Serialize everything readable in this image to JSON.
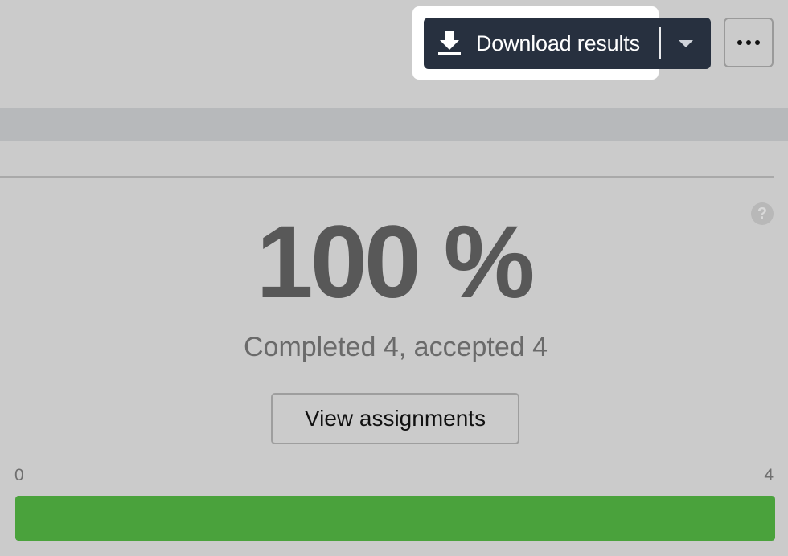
{
  "toolbar": {
    "download_label": "Download results",
    "download_icon": "download-icon",
    "dropdown_icon": "chevron-down-icon",
    "more_icon": "more-horizontal-icon"
  },
  "stats": {
    "percent_text": "100 %",
    "summary": "Completed 4, accepted 4",
    "help_symbol": "?",
    "view_button_label": "View assignments"
  },
  "progress": {
    "min_label": "0",
    "max_label": "4",
    "completed": 4,
    "total": 4,
    "fraction": 1.0
  },
  "colors": {
    "primary_button": "#27303f",
    "progress_fill": "#4aa23c",
    "background": "#cbcbcb"
  }
}
